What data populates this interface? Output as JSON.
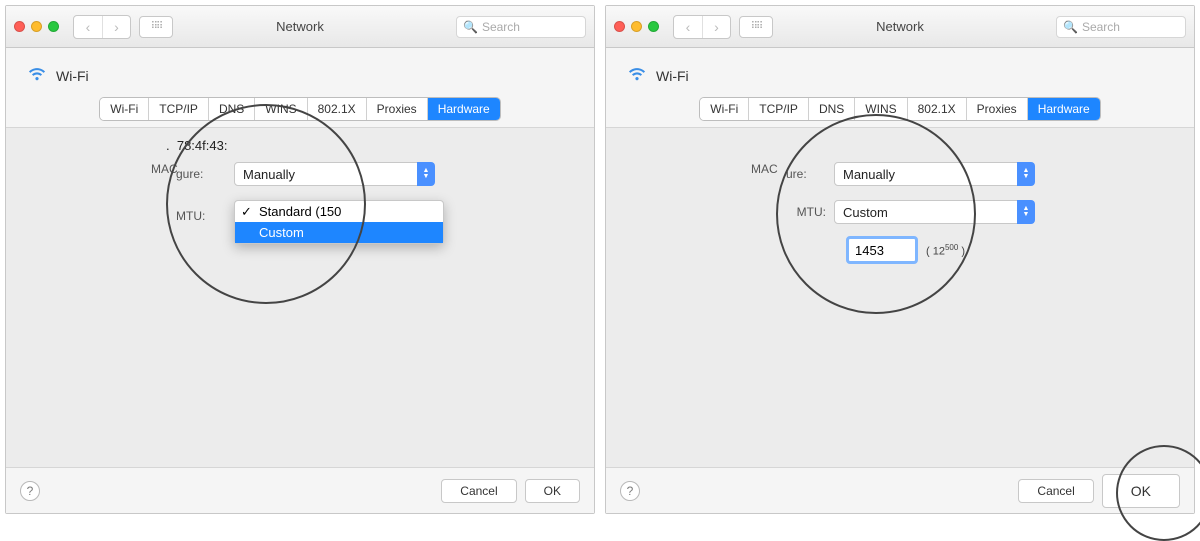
{
  "window_title": "Network",
  "search_placeholder": "Search",
  "header_label": "Wi-Fi",
  "tabs": [
    "Wi-Fi",
    "TCP/IP",
    "DNS",
    "WINS",
    "802.1X",
    "Proxies",
    "Hardware"
  ],
  "selected_tab": "Hardware",
  "mac_label_fragment": "MAC",
  "mac_value_fragment": "78:4f:43:",
  "configure_label_fragment": "gure:",
  "configure_value": "Manually",
  "mtu_label": "MTU:",
  "mtu_dropdown": {
    "options": [
      "Standard  (150",
      "Custom"
    ],
    "checked_index": 0,
    "highlight_index": 1
  },
  "mtu_selected_value": "Custom",
  "mtu_custom_value": "1453",
  "mtu_range_hint_prefix": "( 12",
  "mtu_range_hint_super": "500",
  "mtu_range_hint_suffix": " )",
  "buttons": {
    "cancel": "Cancel",
    "ok": "OK"
  }
}
